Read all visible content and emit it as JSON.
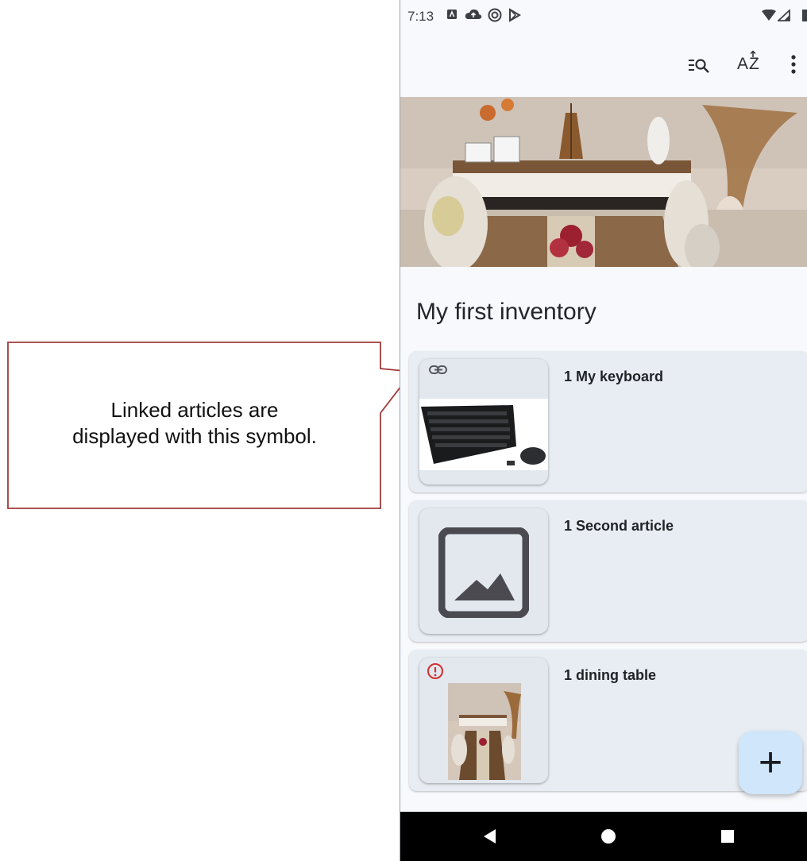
{
  "callout": {
    "text_line1": "Linked articles are",
    "text_line2": "displayed with this symbol."
  },
  "status_bar": {
    "time": "7:13",
    "icons": [
      "notification-a-icon",
      "cloud-icon",
      "sync-icon",
      "play-icon",
      "wifi-icon",
      "signal-icon",
      "battery-icon"
    ]
  },
  "app_bar": {
    "icons": [
      "filter-search-icon",
      "sort-az-icon",
      "more-vert-icon"
    ],
    "sort_label": "AZ"
  },
  "inventory": {
    "title": "My first inventory"
  },
  "articles": [
    {
      "title": "1 My keyboard",
      "badge": "link-icon"
    },
    {
      "title": "1 Second article",
      "badge": ""
    },
    {
      "title": "1 dining table",
      "badge": "error-icon"
    }
  ],
  "fab": {
    "label": "+"
  },
  "colors": {
    "callout_border": "#a23a3a",
    "card_bg": "#e8edf3",
    "fab_bg": "#cfe6fb",
    "error": "#d32f2f"
  }
}
